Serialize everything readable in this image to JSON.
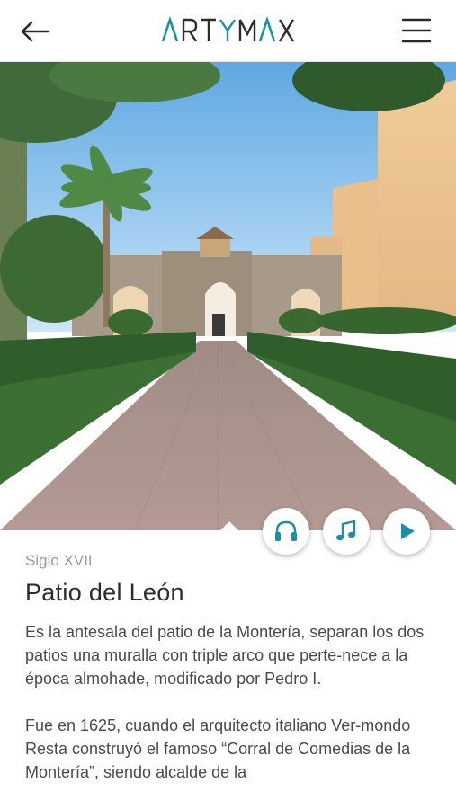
{
  "header": {
    "logo": "ARTYMAX",
    "back_icon": "arrow-left-icon",
    "menu_icon": "hamburger-menu-icon"
  },
  "hero": {
    "subject": "Patio del León"
  },
  "actions": [
    {
      "name": "audio-guide-button",
      "icon": "headphones-icon"
    },
    {
      "name": "music-button",
      "icon": "music-note-icon"
    },
    {
      "name": "play-button",
      "icon": "play-icon"
    }
  ],
  "detail": {
    "century": "Siglo XVII",
    "title": "Patio del León",
    "paragraph_1": "Es la antesala del patio de la Montería, separan los dos patios una muralla con triple arco que perte-nece a la época almohade, modificado por Pedro I.",
    "paragraph_2": "Fue en 1625, cuando el arquitecto italiano Ver-mondo Resta construyó el famoso “Corral de Comedias de la Montería”, siendo alcalde de la"
  },
  "colors": {
    "accent": "#1a8fa6",
    "text_dark": "#2b2b2b",
    "text_body": "#4a4a4a",
    "text_muted": "#9a9a9a"
  }
}
